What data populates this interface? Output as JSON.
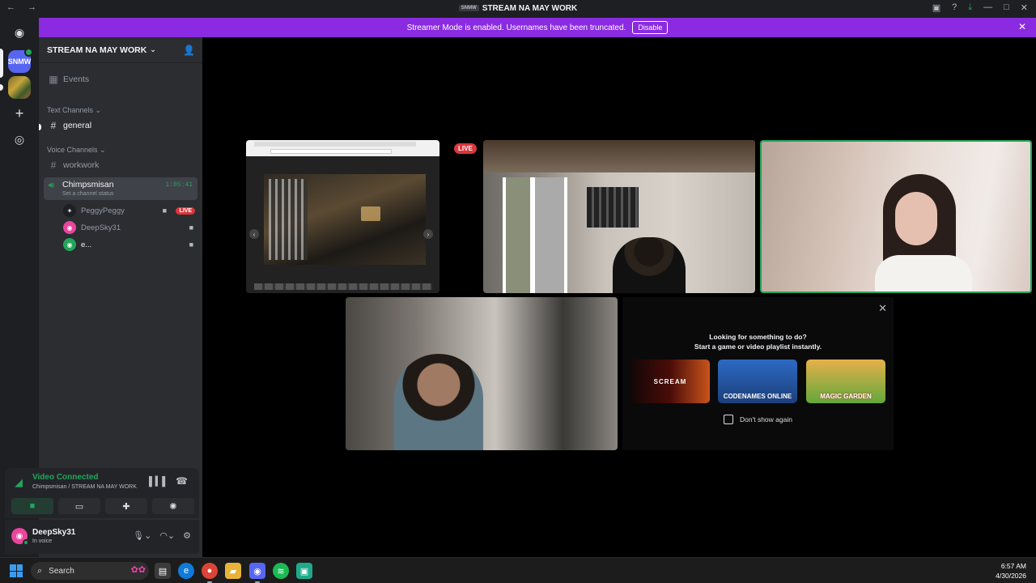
{
  "window": {
    "title": "STREAM NA MAY WORK",
    "title_tag": "SNMW"
  },
  "banner": {
    "text": "Streamer Mode is enabled. Usernames have been truncated.",
    "button": "Disable"
  },
  "guilds": {
    "snm_label": "SNMW"
  },
  "server": {
    "name": "STREAM NA MAY WORK",
    "events_label": "Events",
    "text_category": "Text Channels",
    "voice_category": "Voice Channels",
    "channels": {
      "general": "general",
      "workwork": "workwork",
      "voice_name": "Chimpsmisan",
      "voice_status": "Set a channel status",
      "voice_timer": "1:05:41"
    },
    "members": [
      {
        "name": "PeggyPeggy",
        "live": "LIVE"
      },
      {
        "name": "DeepSky31"
      },
      {
        "name": "e..."
      }
    ]
  },
  "voice_panel": {
    "status": "Video Connected",
    "location": "Chimpsmisan / STREAM NA MAY WORK"
  },
  "user": {
    "name": "DeepSky31",
    "status": "In voice"
  },
  "stage": {
    "live_tag": "LIVE",
    "activity": {
      "line1": "Looking for something to do?",
      "line2": "Start a game or video playlist instantly.",
      "games": [
        "SCREAM",
        "CODENAMES ONLINE",
        "MAGIC GARDEN"
      ],
      "checkbox_label": "Don't show again"
    }
  },
  "taskbar": {
    "search_label": "Search",
    "time": "6:57 AM",
    "date": "4/30/2026"
  },
  "colors": {
    "blurple": "#5865f2",
    "green": "#23a55a",
    "live_red": "#da373c",
    "streamer_banner": "#8a2be2"
  }
}
